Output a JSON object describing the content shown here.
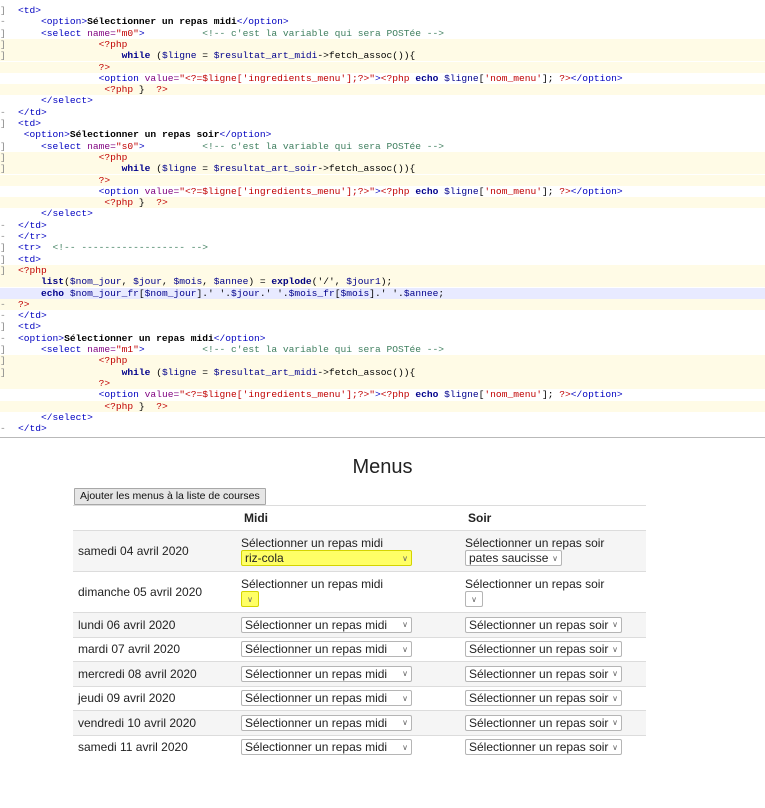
{
  "code": {
    "lines": [
      {
        "g": "]",
        "hl": "",
        "parts": [
          [
            "t-tag",
            "<td>"
          ]
        ]
      },
      {
        "g": "-",
        "hl": "",
        "parts": [
          [
            "t-plain",
            "    "
          ],
          [
            "t-tag",
            "<option>"
          ],
          [
            "t-b",
            "Sélectionner un repas midi"
          ],
          [
            "t-tag",
            "</option>"
          ]
        ]
      },
      {
        "g": "]",
        "hl": "",
        "parts": [
          [
            "t-plain",
            "    "
          ],
          [
            "t-tag",
            "<select "
          ],
          [
            "t-attr",
            "name="
          ],
          [
            "t-str",
            "\"m0\""
          ],
          [
            "t-tag",
            ">"
          ],
          [
            "t-plain",
            "          "
          ],
          [
            "t-com",
            "<!-- c'est la variable qui sera POSTée -->"
          ]
        ]
      },
      {
        "g": "]",
        "hl": "y",
        "parts": [
          [
            "t-plain",
            "              "
          ],
          [
            "t-php",
            "<?php"
          ]
        ]
      },
      {
        "g": "]",
        "hl": "y",
        "parts": [
          [
            "t-plain",
            "                  "
          ],
          [
            "t-kw",
            "while"
          ],
          [
            "t-plain",
            " ("
          ],
          [
            "t-var",
            "$ligne"
          ],
          [
            "t-plain",
            " = "
          ],
          [
            "t-var",
            "$resultat_art_midi"
          ],
          [
            "t-plain",
            "->fetch_assoc()){"
          ]
        ]
      },
      {
        "g": "",
        "hl": "y",
        "parts": [
          [
            "t-plain",
            "              "
          ],
          [
            "t-php",
            "?>"
          ]
        ]
      },
      {
        "g": "",
        "hl": "",
        "parts": [
          [
            "t-plain",
            "              "
          ],
          [
            "t-tag",
            "<option "
          ],
          [
            "t-attr",
            "value="
          ],
          [
            "t-str",
            "\"<?=$ligne["
          ],
          [
            "t-str",
            "'ingredients_menu'"
          ],
          [
            "t-str",
            "];?>\""
          ],
          [
            "t-tag",
            ">"
          ],
          [
            "t-php",
            "<?php "
          ],
          [
            "t-kw",
            "echo"
          ],
          [
            "t-var",
            " $ligne"
          ],
          [
            "t-plain",
            "["
          ],
          [
            "t-str",
            "'nom_menu'"
          ],
          [
            "t-plain",
            "]; "
          ],
          [
            "t-php",
            "?>"
          ],
          [
            "t-tag",
            "</option>"
          ]
        ]
      },
      {
        "g": "",
        "hl": "y",
        "parts": [
          [
            "t-plain",
            "               "
          ],
          [
            "t-php",
            "<?php"
          ],
          [
            "t-plain",
            " }  "
          ],
          [
            "t-php",
            "?>"
          ]
        ]
      },
      {
        "g": "",
        "hl": "",
        "parts": [
          [
            "t-plain",
            "    "
          ],
          [
            "t-tag",
            "</select>"
          ]
        ]
      },
      {
        "g": "-",
        "hl": "",
        "parts": [
          [
            "t-tag",
            "</td>"
          ]
        ]
      },
      {
        "g": "]",
        "hl": "",
        "parts": [
          [
            "t-tag",
            "<td>"
          ]
        ]
      },
      {
        "g": "",
        "hl": "",
        "parts": [
          [
            "t-plain",
            " "
          ],
          [
            "t-tag",
            "<option>"
          ],
          [
            "t-b",
            "Sélectionner un repas soir"
          ],
          [
            "t-tag",
            "</option>"
          ]
        ]
      },
      {
        "g": "]",
        "hl": "",
        "parts": [
          [
            "t-plain",
            "    "
          ],
          [
            "t-tag",
            "<select "
          ],
          [
            "t-attr",
            "name="
          ],
          [
            "t-str",
            "\"s0\""
          ],
          [
            "t-tag",
            ">"
          ],
          [
            "t-plain",
            "          "
          ],
          [
            "t-com",
            "<!-- c'est la variable qui sera POSTée -->"
          ]
        ]
      },
      {
        "g": "]",
        "hl": "y",
        "parts": [
          [
            "t-plain",
            "              "
          ],
          [
            "t-php",
            "<?php"
          ]
        ]
      },
      {
        "g": "]",
        "hl": "y",
        "parts": [
          [
            "t-plain",
            "                  "
          ],
          [
            "t-kw",
            "while"
          ],
          [
            "t-plain",
            " ("
          ],
          [
            "t-var",
            "$ligne"
          ],
          [
            "t-plain",
            " = "
          ],
          [
            "t-var",
            "$resultat_art_soir"
          ],
          [
            "t-plain",
            "->fetch_assoc()){"
          ]
        ]
      },
      {
        "g": "",
        "hl": "y",
        "parts": [
          [
            "t-plain",
            "              "
          ],
          [
            "t-php",
            "?>"
          ]
        ]
      },
      {
        "g": "",
        "hl": "",
        "parts": [
          [
            "t-plain",
            "              "
          ],
          [
            "t-tag",
            "<option "
          ],
          [
            "t-attr",
            "value="
          ],
          [
            "t-str",
            "\"<?=$ligne["
          ],
          [
            "t-str",
            "'ingredients_menu'"
          ],
          [
            "t-str",
            "];?>\""
          ],
          [
            "t-tag",
            ">"
          ],
          [
            "t-php",
            "<?php "
          ],
          [
            "t-kw",
            "echo"
          ],
          [
            "t-var",
            " $ligne"
          ],
          [
            "t-plain",
            "["
          ],
          [
            "t-str",
            "'nom_menu'"
          ],
          [
            "t-plain",
            "]; "
          ],
          [
            "t-php",
            "?>"
          ],
          [
            "t-tag",
            "</option>"
          ]
        ]
      },
      {
        "g": "",
        "hl": "y",
        "parts": [
          [
            "t-plain",
            "               "
          ],
          [
            "t-php",
            "<?php"
          ],
          [
            "t-plain",
            " }  "
          ],
          [
            "t-php",
            "?>"
          ]
        ]
      },
      {
        "g": "",
        "hl": "",
        "parts": [
          [
            "t-plain",
            "    "
          ],
          [
            "t-tag",
            "</select>"
          ]
        ]
      },
      {
        "g": "-",
        "hl": "",
        "parts": [
          [
            "t-tag",
            "</td>"
          ]
        ]
      },
      {
        "g": "-",
        "hl": "",
        "parts": [
          [
            "t-tag",
            "</tr>"
          ]
        ]
      },
      {
        "g": "]",
        "hl": "",
        "parts": [
          [
            "t-tag",
            "<tr>"
          ],
          [
            "t-plain",
            "  "
          ],
          [
            "t-com",
            "<!-- ------------------ -->"
          ]
        ]
      },
      {
        "g": "]",
        "hl": "",
        "parts": [
          [
            "t-tag",
            "<td>"
          ]
        ]
      },
      {
        "g": "]",
        "hl": "y",
        "parts": [
          [
            "t-php",
            "<?php"
          ]
        ]
      },
      {
        "g": "",
        "hl": "y",
        "parts": [
          [
            "t-plain",
            "    "
          ],
          [
            "t-fn",
            "list"
          ],
          [
            "t-plain",
            "("
          ],
          [
            "t-var",
            "$nom_jour"
          ],
          [
            "t-plain",
            ", "
          ],
          [
            "t-var",
            "$jour"
          ],
          [
            "t-plain",
            ", "
          ],
          [
            "t-var",
            "$mois"
          ],
          [
            "t-plain",
            ", "
          ],
          [
            "t-var",
            "$annee"
          ],
          [
            "t-plain",
            ") = "
          ],
          [
            "t-fn",
            "explode"
          ],
          [
            "t-plain",
            "('/', "
          ],
          [
            "t-var",
            "$jour1"
          ],
          [
            "t-plain",
            ");"
          ]
        ]
      },
      {
        "g": "",
        "hl": "b",
        "parts": [
          [
            "t-plain",
            "    "
          ],
          [
            "t-kw",
            "echo"
          ],
          [
            "t-var",
            " $nom_jour_fr"
          ],
          [
            "t-plain",
            "["
          ],
          [
            "t-var",
            "$nom_jour"
          ],
          [
            "t-plain",
            "].' '."
          ],
          [
            "t-var",
            "$jour"
          ],
          [
            "t-plain",
            ".' '."
          ],
          [
            "t-var",
            "$mois_fr"
          ],
          [
            "t-plain",
            "["
          ],
          [
            "t-var",
            "$mois"
          ],
          [
            "t-plain",
            "].' '."
          ],
          [
            "t-var",
            "$annee"
          ],
          [
            "t-plain",
            ";"
          ]
        ]
      },
      {
        "g": "-",
        "hl": "y",
        "parts": [
          [
            "t-php",
            "?>"
          ]
        ]
      },
      {
        "g": "-",
        "hl": "",
        "parts": [
          [
            "t-tag",
            "</td>"
          ]
        ]
      },
      {
        "g": "]",
        "hl": "",
        "parts": [
          [
            "t-tag",
            "<td>"
          ]
        ]
      },
      {
        "g": "-",
        "hl": "",
        "parts": [
          [
            "t-tag",
            "<option>"
          ],
          [
            "t-b",
            "Sélectionner un repas midi"
          ],
          [
            "t-tag",
            "</option>"
          ]
        ]
      },
      {
        "g": "]",
        "hl": "",
        "parts": [
          [
            "t-plain",
            "    "
          ],
          [
            "t-tag",
            "<select "
          ],
          [
            "t-attr",
            "name="
          ],
          [
            "t-str",
            "\"m1\""
          ],
          [
            "t-tag",
            ">"
          ],
          [
            "t-plain",
            "          "
          ],
          [
            "t-com",
            "<!-- c'est la variable qui sera POSTée -->"
          ]
        ]
      },
      {
        "g": "]",
        "hl": "y",
        "parts": [
          [
            "t-plain",
            "              "
          ],
          [
            "t-php",
            "<?php"
          ]
        ]
      },
      {
        "g": "]",
        "hl": "y",
        "parts": [
          [
            "t-plain",
            "                  "
          ],
          [
            "t-kw",
            "while"
          ],
          [
            "t-plain",
            " ("
          ],
          [
            "t-var",
            "$ligne"
          ],
          [
            "t-plain",
            " = "
          ],
          [
            "t-var",
            "$resultat_art_midi"
          ],
          [
            "t-plain",
            "->fetch_assoc()){"
          ]
        ]
      },
      {
        "g": "",
        "hl": "y",
        "parts": [
          [
            "t-plain",
            "              "
          ],
          [
            "t-php",
            "?>"
          ]
        ]
      },
      {
        "g": "",
        "hl": "",
        "parts": [
          [
            "t-plain",
            "              "
          ],
          [
            "t-tag",
            "<option "
          ],
          [
            "t-attr",
            "value="
          ],
          [
            "t-str",
            "\"<?=$ligne["
          ],
          [
            "t-str",
            "'ingredients_menu'"
          ],
          [
            "t-str",
            "];?>\""
          ],
          [
            "t-tag",
            ">"
          ],
          [
            "t-php",
            "<?php "
          ],
          [
            "t-kw",
            "echo"
          ],
          [
            "t-var",
            " $ligne"
          ],
          [
            "t-plain",
            "["
          ],
          [
            "t-str",
            "'nom_menu'"
          ],
          [
            "t-plain",
            "]; "
          ],
          [
            "t-php",
            "?>"
          ],
          [
            "t-tag",
            "</option>"
          ]
        ]
      },
      {
        "g": "",
        "hl": "y",
        "parts": [
          [
            "t-plain",
            "               "
          ],
          [
            "t-php",
            "<?php"
          ],
          [
            "t-plain",
            " }  "
          ],
          [
            "t-php",
            "?>"
          ]
        ]
      },
      {
        "g": "",
        "hl": "",
        "parts": [
          [
            "t-plain",
            "    "
          ],
          [
            "t-tag",
            "</select>"
          ]
        ]
      },
      {
        "g": "-",
        "hl": "",
        "parts": [
          [
            "t-tag",
            "</td>"
          ]
        ]
      }
    ]
  },
  "page": {
    "title": "Menus",
    "add_button_label": "Ajouter les menus à la liste de courses",
    "headers": {
      "date": "",
      "midi": "Midi",
      "soir": "Soir"
    },
    "rows": [
      {
        "date": "samedi 04 avril 2020",
        "midi_label": "Sélectionner un repas midi",
        "midi_value": "riz-cola",
        "midi_hl": true,
        "midi_kind": "wide",
        "soir_label": "Sélectionner un repas soir",
        "soir_value": "pates saucisse",
        "soir_kind": "fit"
      },
      {
        "date": "dimanche 05 avril 2020",
        "midi_label": "Sélectionner un repas midi",
        "midi_value": "",
        "midi_hl": true,
        "midi_kind": "empty",
        "soir_label": "Sélectionner un repas soir",
        "soir_value": "",
        "soir_kind": "empty"
      },
      {
        "date": "lundi 06 avril 2020",
        "midi_label": "",
        "midi_value": "Sélectionner un repas midi",
        "midi_kind": "wide",
        "soir_label": "",
        "soir_value": "Sélectionner un repas soir",
        "soir_kind": "wide"
      },
      {
        "date": "mardi 07 avril 2020",
        "midi_label": "",
        "midi_value": "Sélectionner un repas midi",
        "midi_kind": "wide",
        "soir_label": "",
        "soir_value": "Sélectionner un repas soir",
        "soir_kind": "wide"
      },
      {
        "date": "mercredi 08 avril 2020",
        "midi_label": "",
        "midi_value": "Sélectionner un repas midi",
        "midi_kind": "wide",
        "soir_label": "",
        "soir_value": "Sélectionner un repas soir",
        "soir_kind": "wide"
      },
      {
        "date": "jeudi 09 avril 2020",
        "midi_label": "",
        "midi_value": "Sélectionner un repas midi",
        "midi_kind": "wide",
        "soir_label": "",
        "soir_value": "Sélectionner un repas soir",
        "soir_kind": "wide"
      },
      {
        "date": "vendredi 10 avril 2020",
        "midi_label": "",
        "midi_value": "Sélectionner un repas midi",
        "midi_kind": "wide",
        "soir_label": "",
        "soir_value": "Sélectionner un repas soir",
        "soir_kind": "wide"
      },
      {
        "date": "samedi 11 avril 2020",
        "midi_label": "",
        "midi_value": "Sélectionner un repas midi",
        "midi_kind": "wide",
        "soir_label": "",
        "soir_value": "Sélectionner un repas soir",
        "soir_kind": "wide"
      }
    ],
    "highlight_color": "#ffff66"
  }
}
